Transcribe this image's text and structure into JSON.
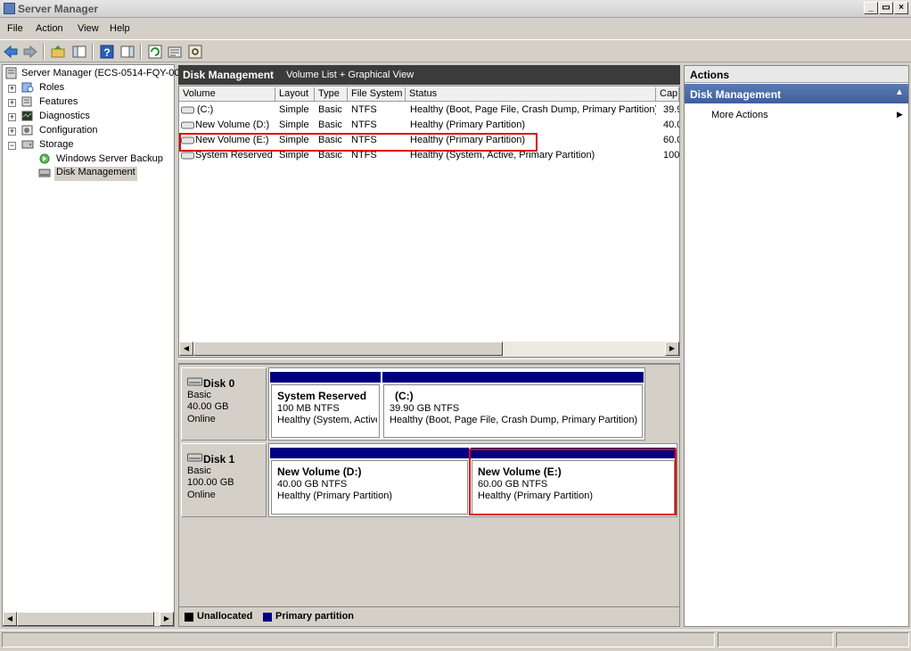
{
  "window": {
    "title": "Server Manager"
  },
  "menu": [
    "File",
    "Action",
    "View",
    "Help"
  ],
  "tree": {
    "root": "Server Manager (ECS-0514-FQY-00",
    "roles": "Roles",
    "features": "Features",
    "diagnostics": "Diagnostics",
    "configuration": "Configuration",
    "storage": "Storage",
    "backup": "Windows Server Backup",
    "disk_mgmt": "Disk Management"
  },
  "center": {
    "title": "Disk Management",
    "subtitle": "Volume List + Graphical View",
    "columns": [
      "Volume",
      "Layout",
      "Type",
      "File System",
      "Status",
      "Cap"
    ],
    "rows": [
      {
        "volume": "(C:)",
        "layout": "Simple",
        "type": "Basic",
        "fs": "NTFS",
        "status": "Healthy (Boot, Page File, Crash Dump, Primary Partition)",
        "cap": "39.9"
      },
      {
        "volume": "New Volume (D:)",
        "layout": "Simple",
        "type": "Basic",
        "fs": "NTFS",
        "status": "Healthy (Primary Partition)",
        "cap": "40.0"
      },
      {
        "volume": "New Volume (E:)",
        "layout": "Simple",
        "type": "Basic",
        "fs": "NTFS",
        "status": "Healthy (Primary Partition)",
        "cap": "60.0"
      },
      {
        "volume": "System Reserved",
        "layout": "Simple",
        "type": "Basic",
        "fs": "NTFS",
        "status": "Healthy (System, Active, Primary Partition)",
        "cap": "100"
      }
    ]
  },
  "disks": [
    {
      "name": "Disk 0",
      "type": "Basic",
      "size": "40.00 GB",
      "status": "Online",
      "volumes": [
        {
          "name": "System Reserved",
          "size": "100 MB NTFS",
          "status": "Healthy (System, Active"
        },
        {
          "name": "(C:)",
          "size": "39.90 GB NTFS",
          "status": "Healthy (Boot, Page File, Crash Dump, Primary Partition)"
        }
      ]
    },
    {
      "name": "Disk 1",
      "type": "Basic",
      "size": "100.00 GB",
      "status": "Online",
      "volumes": [
        {
          "name": "New Volume  (D:)",
          "size": "40.00 GB NTFS",
          "status": "Healthy (Primary Partition)"
        },
        {
          "name": "New Volume  (E:)",
          "size": "60.00 GB NTFS",
          "status": "Healthy (Primary Partition)"
        }
      ]
    }
  ],
  "legend": {
    "unallocated": "Unallocated",
    "primary": "Primary partition"
  },
  "actions": {
    "header": "Actions",
    "section": "Disk Management",
    "more": "More Actions"
  },
  "colors": {
    "highlight": "#e00000",
    "partition": "#00007f",
    "section_bg": "#4a6aa5"
  }
}
